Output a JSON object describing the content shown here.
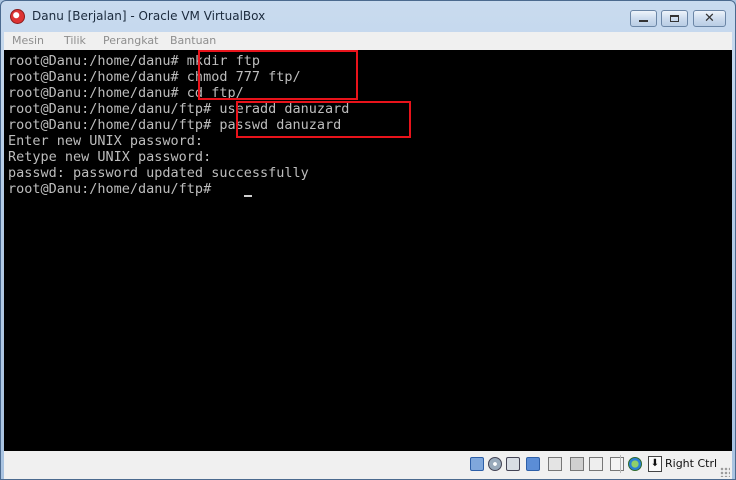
{
  "window": {
    "title": "Danu [Berjalan] - Oracle VM VirtualBox",
    "icon": "virtualbox-icon"
  },
  "menu": {
    "items": [
      "Mesin",
      "Tilik",
      "Perangkat",
      "Bantuan"
    ]
  },
  "console": {
    "lines": [
      "root@Danu:/home/danu# mkdir ftp",
      "root@Danu:/home/danu# chmod 777 ftp/",
      "root@Danu:/home/danu# cd ftp/",
      "root@Danu:/home/danu/ftp# useradd danuzard",
      "root@Danu:/home/danu/ftp# passwd danuzard",
      "Enter new UNIX password:",
      "Retype new UNIX password:",
      "passwd: password updated successfully",
      "root@Danu:/home/danu/ftp# "
    ],
    "highlight_color": "#e8131b",
    "text_color": "#bdbdbd",
    "background": "#000000"
  },
  "statusbar": {
    "host_key_label": "Right Ctrl",
    "icons": [
      "hard-disk-icon",
      "optical-drive-icon",
      "usb-icon",
      "network-icon",
      "shared-folders-icon",
      "video-capture-icon",
      "recording-icon",
      "capture-icon",
      "mouse-integration-icon",
      "keyboard-capture-icon"
    ]
  }
}
